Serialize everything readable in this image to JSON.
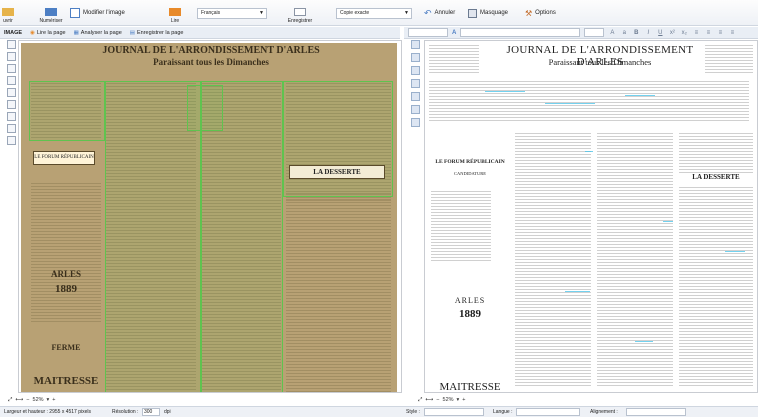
{
  "ribbon": {
    "numeriser": "Numériser",
    "modifier": "Modifier l'image",
    "lire": "Lire",
    "langue": "Français",
    "enregistrer": "Enregistrer",
    "mode": "Copie exacte",
    "annuler": "Annuler",
    "masquage": "Masquage",
    "options": "Options",
    "left_cut": "uvrir"
  },
  "image_toolbar": {
    "label": "IMAGE",
    "lire_page": "Lire la page",
    "analyser_page": "Analyser la page",
    "enregistrer_page": "Enregistrer la page"
  },
  "newspaper": {
    "title": "JOURNAL DE L'ARRONDISSEMENT D'ARLES",
    "subtitle": "Paraissant tous les Dimanches",
    "img_title": "JOURNAL DE L'ARRONDISSEMENT D'ARLES",
    "img_subtitle": "Paraissant tous les Dimanches",
    "le_forum": "LE FORUM RÉPUBLICAIN",
    "candidature": "CANDIDATURE",
    "arles": "ARLES",
    "year": "1889",
    "maitresse": "MAITRESSE",
    "desserte": "LA DESSERTE",
    "ferme": "FERME"
  },
  "zoom": {
    "left_value": "52%",
    "right_value": "52%"
  },
  "status": {
    "dims": "Largeur et hauteur : 2955 x 4517 pixels",
    "resolution_label": "Résolution :",
    "resolution_value": "300",
    "resolution_unit": "dpi",
    "style_label": "Style :",
    "langue_label": "Langue :",
    "alignement_label": "Alignement :"
  },
  "colors": {
    "highlight": "#44c2e8",
    "zone": "#5fc34f",
    "paper": "#b8a174"
  }
}
